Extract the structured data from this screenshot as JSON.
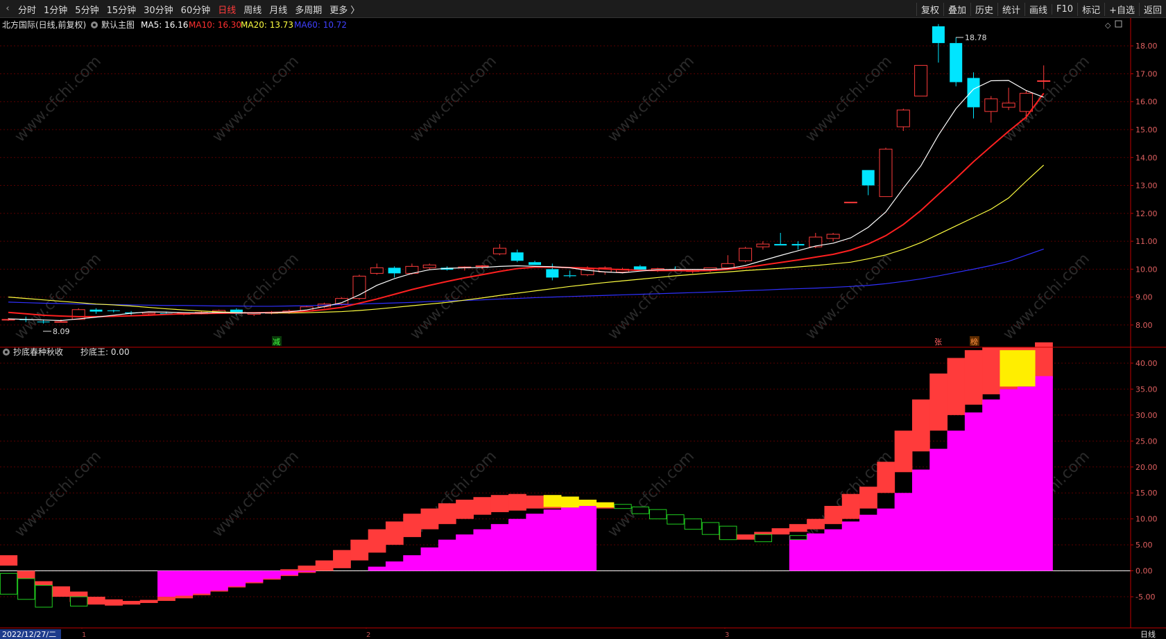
{
  "toolbar": {
    "periods": [
      "分时",
      "1分钟",
      "5分钟",
      "15分钟",
      "30分钟",
      "60分钟",
      "日线",
      "周线",
      "月线",
      "多周期",
      "更多 〉"
    ],
    "active_period": "日线",
    "tools": [
      "复权",
      "叠加",
      "历史",
      "统计",
      "画线",
      "F10",
      "标记",
      "+自选",
      "返回"
    ]
  },
  "main_header": {
    "title": "北方国际(日线,前复权)",
    "template": "默认主图",
    "ma5": "MA5: 16.16",
    "ma10": "MA10: 16.30",
    "ma20": "MA20: 13.73",
    "ma60": "MA60: 10.72"
  },
  "sub_header": {
    "title": "抄底春种秋收",
    "value": "抄底王: 0.00"
  },
  "annotations": {
    "high_label": "18.78",
    "low_label": "8.09",
    "marker_1": "减",
    "marker_2": "张",
    "marker_3": "榜"
  },
  "status": {
    "date": "2022/12/27/二",
    "month_1": "1",
    "month_2": "2",
    "month_3": "3",
    "period_label": "日线"
  },
  "watermark_text": "www.cfchi.com",
  "colors": {
    "up": "#ff3b3b",
    "down": "#00e5ff",
    "ma5": "#ffffff",
    "ma10": "#ff2020",
    "ma20": "#ffff40",
    "ma60": "#3030ff",
    "magenta": "#ff00ff",
    "yellow": "#ffee00",
    "green": "#20d020",
    "axis": "#c00000"
  },
  "chart_data": [
    {
      "type": "candlestick",
      "ylim": [
        7.7,
        18.6
      ],
      "yticks": [
        "8.00",
        "9.00",
        "10.00",
        "11.00",
        "12.00",
        "13.00",
        "14.00",
        "15.00",
        "16.00",
        "17.00",
        "18.00"
      ],
      "ohlc": [
        [
          8.2,
          8.25,
          8.15,
          8.2
        ],
        [
          8.2,
          8.3,
          8.1,
          8.18
        ],
        [
          8.12,
          8.2,
          8.05,
          8.1
        ],
        [
          8.12,
          8.2,
          8.09,
          8.12
        ],
        [
          8.2,
          8.6,
          8.2,
          8.55
        ],
        [
          8.55,
          8.6,
          8.4,
          8.48
        ],
        [
          8.52,
          8.55,
          8.45,
          8.5
        ],
        [
          8.45,
          8.5,
          8.35,
          8.42
        ],
        [
          8.4,
          8.48,
          8.35,
          8.45
        ],
        [
          8.42,
          8.48,
          8.38,
          8.4
        ],
        [
          8.38,
          8.45,
          8.35,
          8.42
        ],
        [
          8.4,
          8.5,
          8.38,
          8.45
        ],
        [
          8.45,
          8.55,
          8.4,
          8.52
        ],
        [
          8.55,
          8.6,
          8.35,
          8.4
        ],
        [
          8.38,
          8.45,
          8.32,
          8.42
        ],
        [
          8.42,
          8.5,
          8.38,
          8.45
        ],
        [
          8.45,
          8.55,
          8.4,
          8.5
        ],
        [
          8.5,
          8.7,
          8.48,
          8.65
        ],
        [
          8.65,
          8.8,
          8.6,
          8.75
        ],
        [
          8.75,
          9.0,
          8.7,
          8.95
        ],
        [
          8.95,
          9.8,
          8.9,
          9.75
        ],
        [
          9.85,
          10.2,
          9.8,
          10.05
        ],
        [
          10.05,
          10.1,
          9.7,
          9.85
        ],
        [
          9.85,
          10.2,
          9.8,
          10.1
        ],
        [
          10.05,
          10.2,
          10.0,
          10.15
        ],
        [
          10.05,
          10.1,
          9.95,
          9.98
        ],
        [
          10.05,
          10.1,
          9.95,
          10.08
        ],
        [
          10.1,
          10.15,
          10.0,
          10.12
        ],
        [
          10.55,
          10.9,
          10.5,
          10.75
        ],
        [
          10.6,
          10.7,
          10.25,
          10.3
        ],
        [
          10.25,
          10.3,
          10.15,
          10.15
        ],
        [
          10.0,
          10.2,
          9.6,
          9.7
        ],
        [
          9.78,
          9.95,
          9.7,
          9.75
        ],
        [
          9.8,
          10.1,
          9.75,
          10.0
        ],
        [
          9.9,
          10.1,
          9.8,
          10.05
        ],
        [
          9.9,
          10.05,
          9.85,
          10.0
        ],
        [
          10.1,
          10.15,
          9.95,
          9.98
        ],
        [
          9.98,
          10.05,
          9.9,
          10.02
        ],
        [
          10.0,
          10.1,
          9.92,
          9.95
        ],
        [
          9.92,
          10.0,
          9.85,
          9.95
        ],
        [
          9.95,
          10.05,
          9.9,
          10.05
        ],
        [
          10.05,
          10.5,
          10.0,
          10.2
        ],
        [
          10.3,
          10.8,
          10.25,
          10.75
        ],
        [
          10.8,
          11.0,
          10.7,
          10.9
        ],
        [
          10.9,
          11.3,
          10.85,
          10.85
        ],
        [
          10.9,
          11.0,
          10.7,
          10.85
        ],
        [
          10.8,
          11.3,
          10.75,
          11.15
        ],
        [
          11.1,
          11.3,
          11.0,
          11.25
        ],
        [
          12.4,
          12.4,
          12.4,
          12.4
        ],
        [
          13.55,
          13.55,
          12.65,
          13.0
        ],
        [
          12.6,
          14.35,
          12.6,
          14.3
        ],
        [
          15.1,
          15.75,
          14.95,
          15.7
        ],
        [
          16.2,
          17.3,
          16.2,
          17.3
        ],
        [
          18.7,
          18.78,
          17.4,
          18.1
        ],
        [
          18.1,
          18.3,
          16.55,
          16.7
        ],
        [
          16.85,
          17.05,
          15.4,
          15.8
        ],
        [
          15.65,
          16.2,
          15.25,
          16.1
        ],
        [
          15.8,
          16.5,
          15.7,
          15.95
        ],
        [
          15.65,
          16.4,
          15.35,
          16.3
        ],
        [
          16.75,
          17.3,
          16.45,
          16.75
        ]
      ],
      "ma5": [
        8.22,
        8.2,
        8.18,
        8.16,
        8.22,
        8.28,
        8.35,
        8.42,
        8.47,
        8.46,
        8.44,
        8.43,
        8.45,
        8.44,
        8.43,
        8.44,
        8.47,
        8.54,
        8.66,
        8.8,
        9.08,
        9.42,
        9.66,
        9.85,
        9.98,
        10.03,
        10.05,
        10.06,
        10.1,
        10.12,
        10.1,
        10.09,
        10.05,
        9.96,
        9.9,
        9.87,
        9.93,
        9.98,
        9.99,
        9.99,
        9.99,
        10.02,
        10.13,
        10.31,
        10.49,
        10.66,
        10.83,
        10.93,
        11.12,
        11.5,
        12.05,
        12.9,
        13.7,
        14.8,
        15.75,
        16.45,
        16.75,
        16.76,
        16.4,
        16.16
      ],
      "ma10": [
        8.45,
        8.4,
        8.35,
        8.32,
        8.3,
        8.3,
        8.31,
        8.33,
        8.35,
        8.38,
        8.4,
        8.41,
        8.42,
        8.43,
        8.44,
        8.45,
        8.46,
        8.49,
        8.55,
        8.63,
        8.78,
        8.93,
        9.1,
        9.27,
        9.42,
        9.56,
        9.69,
        9.8,
        9.92,
        10.02,
        10.07,
        10.07,
        10.06,
        10.04,
        10.01,
        9.98,
        9.96,
        9.95,
        9.95,
        9.94,
        9.95,
        9.99,
        10.06,
        10.15,
        10.24,
        10.33,
        10.43,
        10.53,
        10.68,
        10.9,
        11.2,
        11.6,
        12.1,
        12.68,
        13.25,
        13.85,
        14.4,
        14.94,
        15.45,
        16.3
      ],
      "ma20": [
        9.0,
        8.95,
        8.9,
        8.85,
        8.8,
        8.75,
        8.72,
        8.68,
        8.63,
        8.58,
        8.54,
        8.5,
        8.47,
        8.45,
        8.44,
        8.43,
        8.43,
        8.44,
        8.46,
        8.48,
        8.52,
        8.57,
        8.63,
        8.69,
        8.75,
        8.81,
        8.89,
        8.97,
        9.06,
        9.14,
        9.22,
        9.3,
        9.38,
        9.45,
        9.52,
        9.58,
        9.64,
        9.7,
        9.76,
        9.81,
        9.86,
        9.9,
        9.95,
        9.99,
        10.03,
        10.08,
        10.13,
        10.19,
        10.25,
        10.37,
        10.51,
        10.71,
        10.95,
        11.25,
        11.55,
        11.85,
        12.15,
        12.55,
        13.15,
        13.73
      ],
      "ma60": [
        8.82,
        8.8,
        8.78,
        8.77,
        8.75,
        8.74,
        8.73,
        8.72,
        8.71,
        8.7,
        8.7,
        8.69,
        8.68,
        8.68,
        8.67,
        8.67,
        8.68,
        8.69,
        8.71,
        8.73,
        8.75,
        8.77,
        8.79,
        8.81,
        8.84,
        8.86,
        8.88,
        8.9,
        8.93,
        8.95,
        8.98,
        9.0,
        9.02,
        9.04,
        9.06,
        9.08,
        9.1,
        9.12,
        9.14,
        9.16,
        9.18,
        9.2,
        9.23,
        9.25,
        9.28,
        9.3,
        9.32,
        9.35,
        9.38,
        9.42,
        9.48,
        9.56,
        9.65,
        9.76,
        9.88,
        10.0,
        10.13,
        10.28,
        10.5,
        10.72
      ]
    },
    {
      "type": "bar",
      "ylim": [
        -11,
        44
      ],
      "yticks": [
        "-5.00",
        "0.00",
        "5.00",
        "10.00",
        "15.00",
        "20.00",
        "25.00",
        "30.00",
        "35.00",
        "40.00"
      ],
      "red": [
        [
          1,
          3
        ],
        [
          -2,
          0
        ],
        [
          -4,
          -2
        ],
        [
          -5,
          -3
        ],
        [
          -6,
          -4
        ],
        [
          -6.5,
          -5
        ],
        [
          -6.7,
          -5.5
        ],
        [
          -6.5,
          -5.8
        ],
        [
          -6.2,
          -5.6
        ],
        [
          -5.8,
          -5
        ],
        [
          -5.3,
          -4.4
        ],
        [
          -4.7,
          -3.7
        ],
        [
          -4,
          -2.9
        ],
        [
          -3.2,
          -2
        ],
        [
          -2.4,
          -1.2
        ],
        [
          -1.7,
          -0.5
        ],
        [
          -1,
          0.3
        ],
        [
          -0.4,
          1
        ],
        [
          0,
          2
        ],
        [
          0.5,
          4
        ],
        [
          2,
          6
        ],
        [
          3.5,
          8
        ],
        [
          5,
          9.5
        ],
        [
          6.5,
          11
        ],
        [
          8,
          12
        ],
        [
          9,
          13
        ],
        [
          10,
          13.7
        ],
        [
          10.8,
          14.2
        ],
        [
          11.3,
          14.6
        ],
        [
          11.6,
          14.8
        ],
        [
          12,
          14.5
        ],
        [
          12,
          14
        ],
        [
          12,
          13.5
        ],
        [
          12,
          13
        ],
        [
          12,
          12.5
        ],
        [
          12,
          12.3
        ],
        [
          12,
          12
        ],
        [
          12,
          12
        ],
        [
          12,
          12
        ],
        [
          12,
          12
        ],
        [
          12,
          12
        ],
        [
          6,
          7
        ],
        [
          6,
          7
        ],
        [
          6.5,
          7.5
        ],
        [
          7,
          8.2
        ],
        [
          7.5,
          9
        ],
        [
          8,
          10
        ],
        [
          9,
          12.5
        ],
        [
          10,
          14.8
        ],
        [
          12,
          16.2
        ],
        [
          15,
          21
        ],
        [
          19,
          27
        ],
        [
          23,
          33
        ],
        [
          27,
          38
        ],
        [
          30,
          41
        ],
        [
          32,
          42.5
        ],
        [
          34,
          43
        ],
        [
          35,
          43
        ],
        [
          36,
          43
        ],
        [
          37,
          44
        ]
      ],
      "magenta": [
        [
          0,
          0
        ],
        [
          0,
          0
        ],
        [
          0,
          0
        ],
        [
          0,
          0
        ],
        [
          0,
          0
        ],
        [
          0,
          0
        ],
        [
          0,
          0
        ],
        [
          0,
          0
        ],
        [
          0,
          0
        ],
        [
          0,
          -5
        ],
        [
          0,
          -4.8
        ],
        [
          0,
          -4.4
        ],
        [
          0,
          -3.8
        ],
        [
          0,
          -3
        ],
        [
          0,
          -2.2
        ],
        [
          0,
          -1.5
        ],
        [
          0,
          -0.8
        ],
        [
          0,
          -0.2
        ],
        [
          0,
          0
        ],
        [
          0,
          0
        ],
        [
          0,
          0
        ],
        [
          0,
          0.8
        ],
        [
          0,
          1.8
        ],
        [
          0,
          3
        ],
        [
          0,
          4.5
        ],
        [
          0,
          6
        ],
        [
          0,
          7
        ],
        [
          0,
          8
        ],
        [
          0,
          9
        ],
        [
          0,
          10
        ],
        [
          0,
          11
        ],
        [
          0,
          11.8
        ],
        [
          0,
          12.2
        ],
        [
          0,
          12.5
        ],
        [
          0,
          0
        ],
        [
          0,
          0
        ],
        [
          0,
          0
        ],
        [
          0,
          0
        ],
        [
          0,
          0
        ],
        [
          0,
          0
        ],
        [
          0,
          0
        ],
        [
          0,
          0
        ],
        [
          0,
          0
        ],
        [
          0,
          0
        ],
        [
          0,
          0
        ],
        [
          0,
          6.8
        ],
        [
          0,
          7.2
        ],
        [
          0,
          8
        ],
        [
          0,
          9.5
        ],
        [
          0,
          10.8
        ],
        [
          0,
          12
        ],
        [
          0,
          15
        ],
        [
          0,
          19.5
        ],
        [
          0,
          23.5
        ],
        [
          0,
          27
        ],
        [
          0,
          30.5
        ],
        [
          0,
          33
        ],
        [
          0,
          35
        ],
        [
          0,
          35.5
        ],
        [
          0,
          37.5
        ]
      ],
      "yellow": [
        [
          31,
          12.3,
          14.6
        ],
        [
          32,
          12.2,
          14.3
        ],
        [
          33,
          12.5,
          13.7
        ],
        [
          34,
          12.2,
          13.2
        ],
        [
          57,
          35.5,
          42.5
        ],
        [
          58,
          35.5,
          42.5
        ]
      ],
      "green": [
        [
          0,
          -4.5,
          -0.5
        ],
        [
          1,
          -5.5,
          -1.5
        ],
        [
          2,
          -7,
          -2.8
        ],
        [
          4,
          -6.8,
          -5
        ],
        [
          35,
          12,
          12.8
        ],
        [
          36,
          11,
          12.3
        ],
        [
          37,
          10,
          11.8
        ],
        [
          38,
          9,
          10.8
        ],
        [
          39,
          8,
          10
        ],
        [
          40,
          7,
          9.3
        ],
        [
          41,
          6,
          8.6
        ],
        [
          43,
          5.6,
          7
        ],
        [
          45,
          6,
          6.8
        ]
      ]
    }
  ]
}
